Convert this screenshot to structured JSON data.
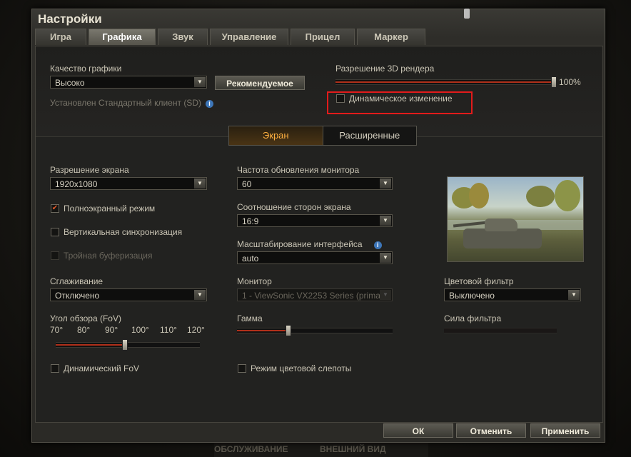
{
  "window": {
    "title": "Настройки"
  },
  "tabs": [
    "Игра",
    "Графика",
    "Звук",
    "Управление",
    "Прицел",
    "Маркер"
  ],
  "graphics": {
    "quality_label": "Качество графики",
    "quality_value": "Высоко",
    "recommended_button": "Рекомендуемое",
    "client_info": "Установлен Стандартный клиент (SD)",
    "render_label": "Разрешение 3D рендера",
    "render_value": "100%",
    "render_level": 1.0,
    "dynamic_change": "Динамическое изменение"
  },
  "subtabs": [
    "Экран",
    "Расширенные"
  ],
  "screen": {
    "resolution_label": "Разрешение экрана",
    "resolution_value": "1920x1080",
    "fullscreen": "Полноэкранный режим",
    "vsync": "Вертикальная синхронизация",
    "triple_buffer": "Тройная буферизация",
    "aa_label": "Сглаживание",
    "aa_value": "Отключено",
    "fov_label": "Угол обзора (FoV)",
    "fov_ticks": [
      "70°",
      "80°",
      "90°",
      "100°",
      "110°",
      "120°"
    ],
    "fov_level": 0.48,
    "dynamic_fov": "Динамический FoV",
    "refresh_label": "Частота обновления монитора",
    "refresh_value": "60",
    "aspect_label": "Соотношение сторон экрана",
    "aspect_value": "16:9",
    "ui_scale_label": "Масштабирование интерфейса",
    "ui_scale_value": "auto",
    "monitor_label": "Монитор",
    "monitor_value": "1 - ViewSonic VX2253 Series (prima",
    "gamma_label": "Гамма",
    "gamma_level": 0.33,
    "colorblind": "Режим цветовой слепоты",
    "color_filter_label": "Цветовой фильтр",
    "color_filter_value": "Выключено",
    "filter_strength_label": "Сила фильтра"
  },
  "footer": {
    "ok": "ОК",
    "cancel": "Отменить",
    "apply": "Применить"
  },
  "background": {
    "bottom_left": "ОБСЛУЖИВАНИЕ",
    "bottom_right": "ВНЕШНИЙ ВИД"
  },
  "colors": {
    "accent": "#ffb040",
    "highlight": "#e21b1b",
    "checkmark": "#e25a2a"
  },
  "icons": [
    "info-icon",
    "chevron-down-icon",
    "checkmark-icon"
  ]
}
